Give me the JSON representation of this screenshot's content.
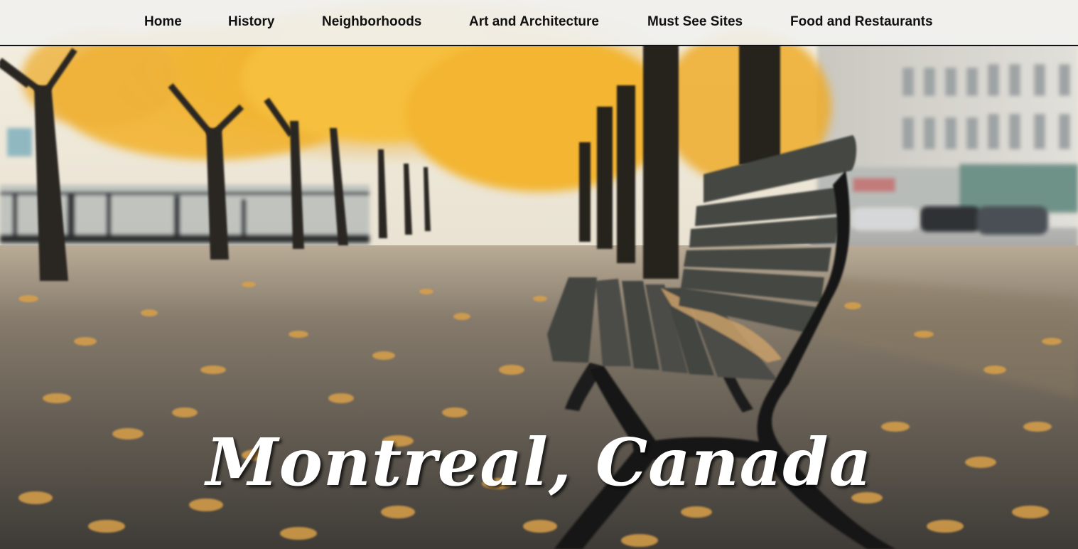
{
  "nav": {
    "items": [
      {
        "label": "Home"
      },
      {
        "label": "History"
      },
      {
        "label": "Neighborhoods"
      },
      {
        "label": "Art and Architecture"
      },
      {
        "label": "Must See Sites"
      },
      {
        "label": "Food and Restaurants"
      }
    ]
  },
  "hero": {
    "title": "Montreal, Canada",
    "image_icon": "autumn-park-bench-photo"
  },
  "colors": {
    "nav_background": "#f0f0ee",
    "nav_text": "#111111",
    "title_text": "#ffffff",
    "foliage": "#f2b431",
    "bench": "#3e3f3b"
  }
}
